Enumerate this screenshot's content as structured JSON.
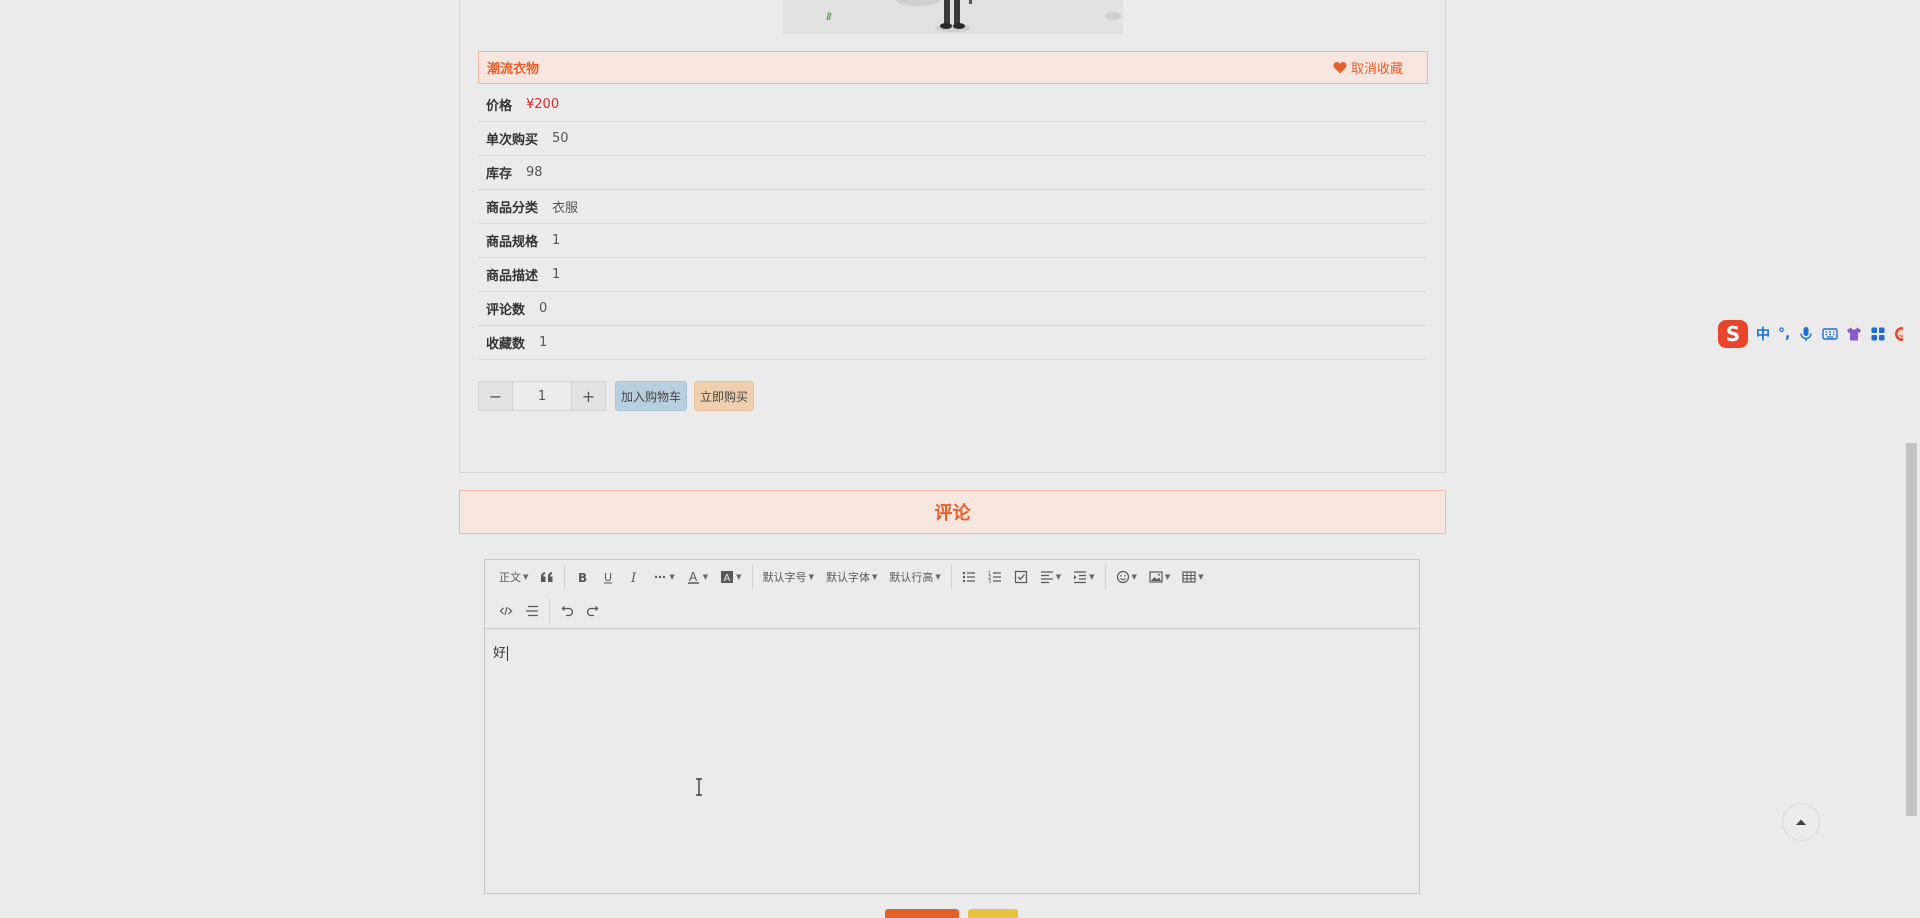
{
  "product": {
    "name": "潮流衣物",
    "favorite_label": "取消收藏",
    "fields": [
      {
        "label": "价格",
        "value": "¥200"
      },
      {
        "label": "单次购买",
        "value": "50"
      },
      {
        "label": "库存",
        "value": "98"
      },
      {
        "label": "商品分类",
        "value": "衣服"
      },
      {
        "label": "商品规格",
        "value": "1"
      },
      {
        "label": "商品描述",
        "value": "1"
      },
      {
        "label": "评论数",
        "value": "0"
      },
      {
        "label": "收藏数",
        "value": "1"
      }
    ],
    "quantity": "1",
    "minus_label": "−",
    "plus_label": "+",
    "add_to_cart_label": "加入购物车",
    "buy_now_label": "立即购买"
  },
  "comment": {
    "header": "评论",
    "editor_text": "好",
    "toolbar": {
      "paragraph": "正文",
      "font_size": "默认字号",
      "font_family": "默认字体",
      "line_height": "默认行高"
    }
  },
  "ime": {
    "logo": "S",
    "lang": "中",
    "punct": "°,"
  },
  "colors": {
    "accent": "#e6602c",
    "price": "#d72a2a",
    "background": "#ebebeb",
    "cart_button": "#b8cfdf",
    "buy_button": "#f0cfae",
    "submit_button": "#e6602c",
    "reset_button": "#e8c33f"
  }
}
